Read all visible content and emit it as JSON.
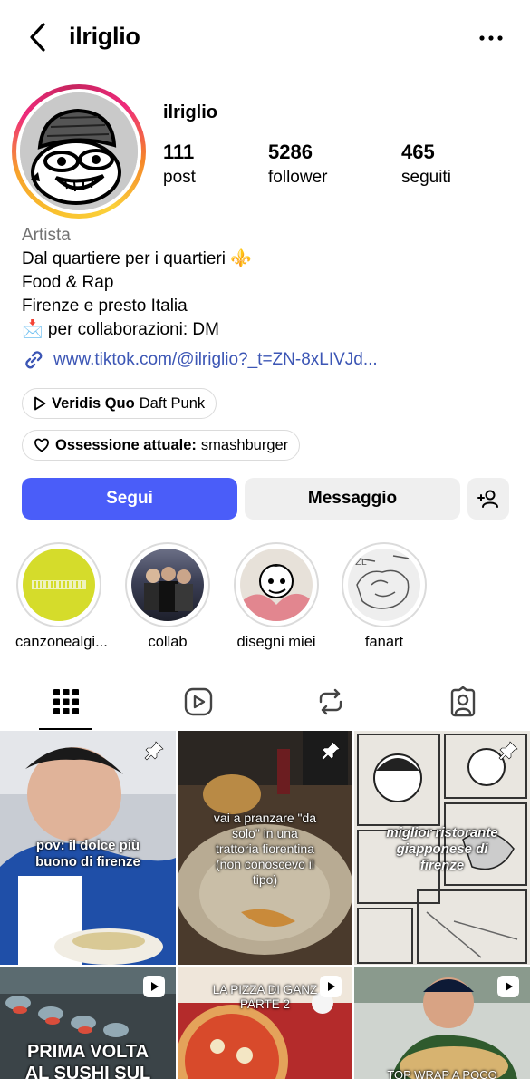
{
  "header": {
    "title": "ilriglio",
    "back_icon": "chevron-left-icon",
    "more_icon": "more-horizontal-icon"
  },
  "profile": {
    "username": "ilriglio",
    "stats": [
      {
        "value": "111",
        "label": "post"
      },
      {
        "value": "5286",
        "label": "follower"
      },
      {
        "value": "465",
        "label": "seguiti"
      }
    ],
    "category": "Artista",
    "bio_lines": [
      "Dal quartiere per i quartieri ⚜️",
      "Food & Rap",
      "Firenze e presto Italia",
      "📩 per collaborazioni: DM"
    ],
    "link": "www.tiktok.com/@ilriglio?_t=ZN-8xLIVJd..."
  },
  "music_pill": {
    "song": "Veridis Quo",
    "artist": "Daft Punk"
  },
  "obsession_pill": {
    "label": "Ossessione attuale:",
    "value": "smashburger"
  },
  "actions": {
    "follow": "Segui",
    "message": "Messaggio"
  },
  "highlights": [
    {
      "label": "canzonealgi..."
    },
    {
      "label": "collab"
    },
    {
      "label": "disegni miei"
    },
    {
      "label": "fanart"
    }
  ],
  "tabs": [
    "grid-icon",
    "reels-icon",
    "reposts-icon",
    "tagged-icon"
  ],
  "posts": [
    {
      "caption": "pov: il dolce più\nbuono di firenze",
      "pinned": true
    },
    {
      "caption": "vai a pranzare \"da\nsolo\" in una\ntrattoria fiorentina\n(non conoscevo il\ntipo)",
      "pinned": true
    },
    {
      "caption": "miglior ristorante\ngiapponese di\nfirenze",
      "pinned": true
    },
    {
      "caption": "PRIMA VOLTA\nAL SUSHI SUL",
      "reel": true
    },
    {
      "caption": "LA PIZZA DI GANZ\nPARTE 2",
      "reel": true
    },
    {
      "caption": "TOP WRAP A POCO",
      "reel": true
    }
  ],
  "colors": {
    "accent": "#4a5df9",
    "link": "#3c56b5",
    "muted": "#737373"
  }
}
